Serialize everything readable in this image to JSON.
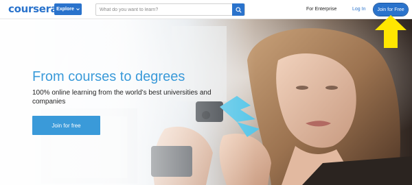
{
  "header": {
    "logo_text": "coursera",
    "explore_label": "Explore",
    "search_placeholder": "What do you want to learn?",
    "enterprise_label": "For Enterprise",
    "login_label": "Log In",
    "join_label": "Join for Free"
  },
  "hero": {
    "title": "From courses to degrees",
    "subtitle": "100% online learning from the world’s best universities and companies",
    "cta_label": "Join for free"
  },
  "colors": {
    "brand_blue": "#2a73cc",
    "hero_blue": "#3a9ad9",
    "annotation_yellow": "#ffe600"
  },
  "icons": {
    "explore_chevron": "chevron-down-icon",
    "search": "search-icon",
    "annotation": "arrow-up-icon"
  }
}
